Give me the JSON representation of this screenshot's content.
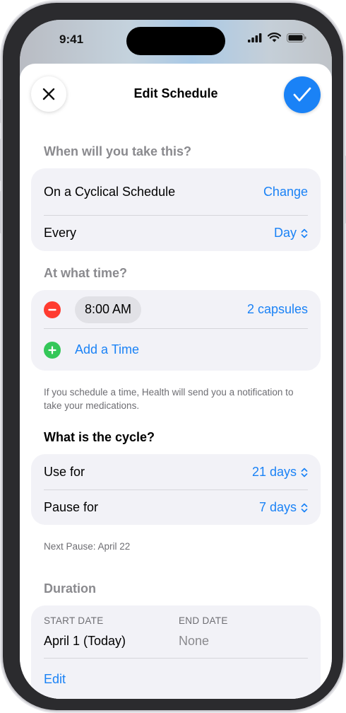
{
  "status_bar": {
    "time": "9:41"
  },
  "nav": {
    "title": "Edit Schedule"
  },
  "schedule": {
    "question": "When will you take this?",
    "type_label": "On a Cyclical Schedule",
    "change_label": "Change",
    "every_label": "Every",
    "every_value": "Day"
  },
  "times": {
    "question": "At what time?",
    "time_value": "8:00 AM",
    "dose": "2 capsules",
    "add_label": "Add a Time",
    "footnote": "If you schedule a time, Health will send you a notification to take your medications."
  },
  "cycle": {
    "question": "What is the cycle?",
    "use_label": "Use for",
    "use_value": "21 days",
    "pause_label": "Pause for",
    "pause_value": "7 days",
    "next_pause": "Next Pause: April 22"
  },
  "duration": {
    "title": "Duration",
    "start_header": "START DATE",
    "start_value": "April 1 (Today)",
    "end_header": "END DATE",
    "end_value": "None",
    "edit_label": "Edit"
  },
  "colors": {
    "accent": "#1a82f6",
    "remove": "#ff3b30",
    "add": "#34c759"
  }
}
